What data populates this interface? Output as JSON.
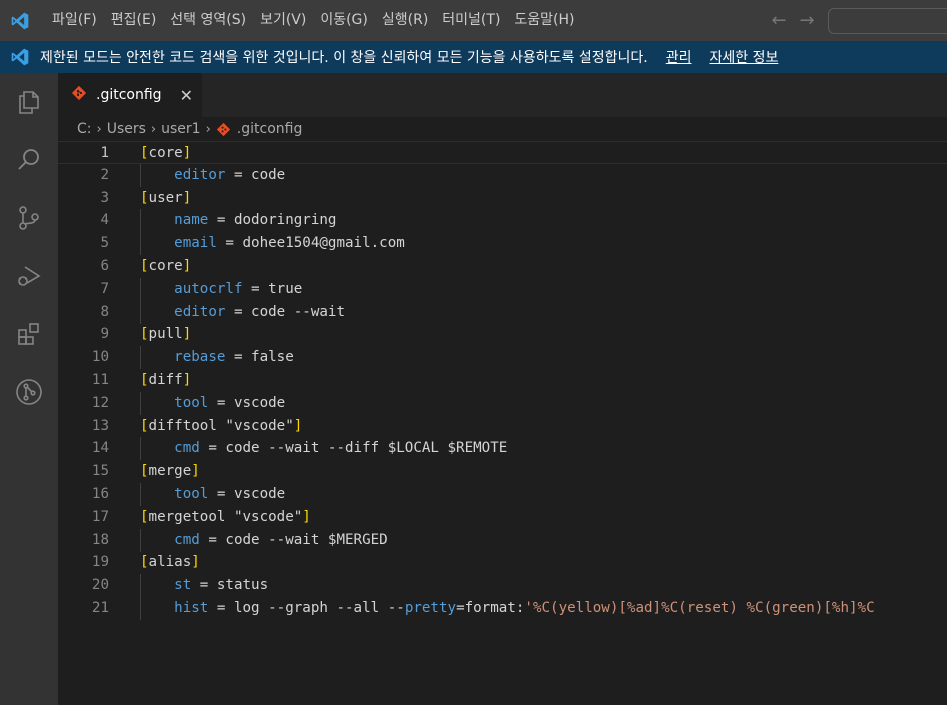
{
  "menu": [
    "파일(F)",
    "편집(E)",
    "선택 영역(S)",
    "보기(V)",
    "이동(G)",
    "실행(R)",
    "터미널(T)",
    "도움말(H)"
  ],
  "nav": {
    "back": "←",
    "forward": "→"
  },
  "banner": {
    "text": "제한된 모드는 안전한 코드 검색을 위한 것입니다. 이 창을 신뢰하여 모든 기능을 사용하도록 설정합니다.",
    "link_manage": "관리",
    "link_more": "자세한 정보"
  },
  "tab": {
    "label": ".gitconfig",
    "close": "✕"
  },
  "breadcrumb": [
    "C:",
    "Users",
    "user1",
    ".gitconfig"
  ],
  "lines": [
    {
      "n": "1",
      "section": "core"
    },
    {
      "n": "2",
      "key": "editor",
      "value": "code"
    },
    {
      "n": "3",
      "section": "user"
    },
    {
      "n": "4",
      "key": "name",
      "value": "dodoringring"
    },
    {
      "n": "5",
      "key": "email",
      "value": "dohee1504@gmail.com"
    },
    {
      "n": "6",
      "section": "core"
    },
    {
      "n": "7",
      "key": "autocrlf",
      "value": "true"
    },
    {
      "n": "8",
      "key": "editor",
      "value": "code --wait"
    },
    {
      "n": "9",
      "section": "pull"
    },
    {
      "n": "10",
      "key": "rebase",
      "value": "false"
    },
    {
      "n": "11",
      "section": "diff"
    },
    {
      "n": "12",
      "key": "tool",
      "value": "vscode"
    },
    {
      "n": "13",
      "section": "difftool \"vscode\""
    },
    {
      "n": "14",
      "key": "cmd",
      "value": "code --wait --diff $LOCAL $REMOTE"
    },
    {
      "n": "15",
      "section": "merge"
    },
    {
      "n": "16",
      "key": "tool",
      "value": "vscode"
    },
    {
      "n": "17",
      "section": "mergetool \"vscode\""
    },
    {
      "n": "18",
      "key": "cmd",
      "value": "code --wait $MERGED"
    },
    {
      "n": "19",
      "section": "alias"
    },
    {
      "n": "20",
      "key": "st",
      "value": "status"
    },
    {
      "n": "21",
      "key": "hist",
      "value_pre": "log --graph --all --",
      "value_key": "pretty",
      "value_post": "=format:",
      "value_str": "'%C(yellow)[%ad]%C(reset) %C(green)[%h]%C"
    }
  ],
  "active_line": "1",
  "colors": {
    "accent": "#007acc",
    "banner": "#0e3a5c",
    "git_icon": "#e44d26"
  }
}
